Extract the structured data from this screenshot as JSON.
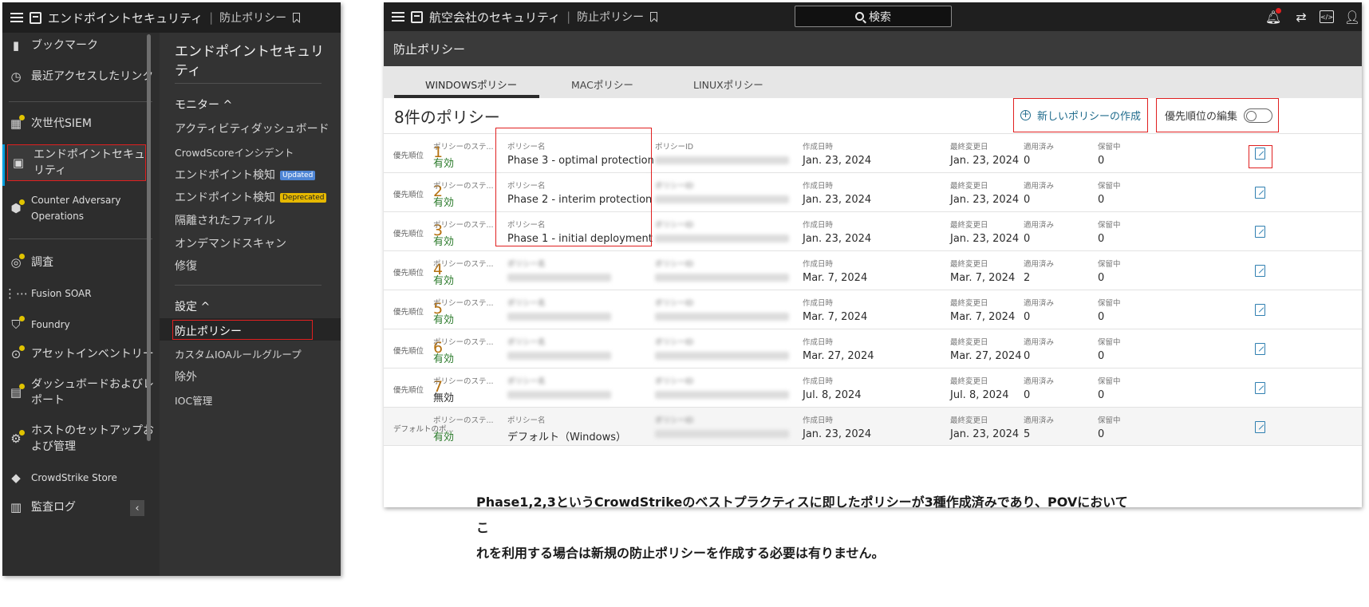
{
  "nav": {
    "topbar": {
      "app": "エンドポイントセキュリティ",
      "separator": "|",
      "page": "防止ポリシー"
    },
    "primary_items": [
      {
        "label": "ブックマーク",
        "icon": "bookmark-icon"
      },
      {
        "label": "最近アクセスしたリンク",
        "icon": "history-icon"
      },
      {
        "label": "次世代SIEM",
        "icon": "siem-icon"
      },
      {
        "label": "エンドポイントセキュリティ",
        "icon": "endpoint-icon"
      },
      {
        "label": "Counter Adversary Operations",
        "icon": "adversary-icon"
      },
      {
        "label": "調査",
        "icon": "investigate-icon"
      },
      {
        "label": "Fusion SOAR",
        "icon": "workflow-icon"
      },
      {
        "label": "Foundry",
        "icon": "foundry-icon"
      },
      {
        "label": "アセットインベントリー",
        "icon": "asset-icon"
      },
      {
        "label": "ダッシュボードおよびレポート",
        "icon": "dashboard-icon"
      },
      {
        "label": "ホストのセットアップおよび管理",
        "icon": "host-setup-icon"
      },
      {
        "label": "CrowdStrike Store",
        "icon": "store-icon"
      },
      {
        "label": "監査ログ",
        "icon": "audit-log-icon"
      }
    ],
    "secondary": {
      "title": "エンドポイントセキュリティ",
      "monitor_section": "モニター ^",
      "monitor_links": [
        "アクティビティダッシュボード",
        "CrowdScoreインシデント",
        "エンドポイント検知",
        "エンドポイント検知",
        "隔離されたファイル",
        "オンデマンドスキャン",
        "修復"
      ],
      "badge_updated": "Updated",
      "badge_deprecated": "Deprecated",
      "settings_section": "設定 ^",
      "settings_links": [
        "防止ポリシー",
        "カスタムIOAルールグループ",
        "除外",
        "IOC管理"
      ]
    },
    "collapse_glyph": "‹"
  },
  "main": {
    "topbar": {
      "title": "航空会社のセキュリティ",
      "separator": "|",
      "page": "防止ポリシー",
      "search": "検索"
    },
    "page_title": "防止ポリシー",
    "tabs": [
      "WINDOWSポリシー",
      "MACポリシー",
      "LINUXポリシー"
    ],
    "policy_count": "8件のポリシー",
    "new_policy": "新しいポリシーの作成",
    "priority_edit": "優先順位の編集",
    "columns": {
      "priority": "優先順位",
      "status": "ポリシーのステ...",
      "name": "ポリシー名",
      "id": "ポリシーID",
      "created": "作成日時",
      "modified": "最終変更日",
      "applied": "適用済み",
      "pending": "保留中"
    },
    "rows": [
      {
        "priority": "1",
        "status": "有効",
        "name": "Phase 3 - optimal protection",
        "created": "Jan. 23, 2024",
        "modified": "Jan. 23, 2024",
        "applied": "0",
        "pending": "0"
      },
      {
        "priority": "2",
        "status": "有効",
        "name": "Phase 2 - interim protection",
        "created": "Jan. 23, 2024",
        "modified": "Jan. 23, 2024",
        "applied": "0",
        "pending": "0"
      },
      {
        "priority": "3",
        "status": "有効",
        "name": "Phase 1 - initial deployment",
        "created": "Jan. 23, 2024",
        "modified": "Jan. 23, 2024",
        "applied": "0",
        "pending": "0"
      },
      {
        "priority": "4",
        "status": "有効",
        "name": "",
        "created": "Mar. 7, 2024",
        "modified": "Mar. 7, 2024",
        "applied": "2",
        "pending": "0"
      },
      {
        "priority": "5",
        "status": "有効",
        "name": "",
        "created": "Mar. 7, 2024",
        "modified": "Mar. 7, 2024",
        "applied": "0",
        "pending": "0"
      },
      {
        "priority": "6",
        "status": "有効",
        "name": "",
        "created": "Mar. 27, 2024",
        "modified": "Mar. 27, 2024",
        "applied": "0",
        "pending": "0"
      },
      {
        "priority": "7",
        "status": "無効",
        "name": "",
        "created": "Jul. 8, 2024",
        "modified": "Jul. 8, 2024",
        "applied": "0",
        "pending": "0"
      }
    ],
    "default_row": {
      "priority_label": "デフォルトのポ...",
      "status": "有効",
      "name": "デフォルト（Windows）",
      "created": "Jan. 23, 2024",
      "modified": "Jan. 23, 2024",
      "applied": "5",
      "pending": "0"
    }
  },
  "caption": {
    "line1": "Phase1,2,3というCrowdStrikeのベストプラクティスに即したポリシーが3種作成済みであり、POVにおいてこ",
    "line2": "れを利用する場合は新規の防止ポリシーを作成する必要は有りません。"
  },
  "colors": {
    "highlight": "#e02020",
    "priority_number": "#b5700e",
    "enabled_status": "#2a7a2a",
    "link": "#1f6b8c"
  }
}
